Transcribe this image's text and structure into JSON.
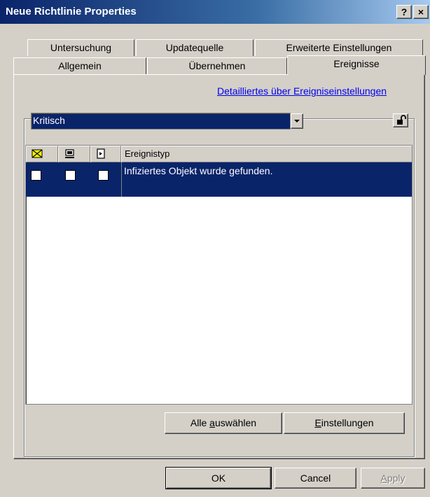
{
  "window": {
    "title": "Neue Richtlinie Properties",
    "help_button": "?",
    "close_button": "×"
  },
  "tabs": {
    "row_top": [
      "Untersuchung",
      "Updatequelle",
      "Erweiterte Einstellungen"
    ],
    "row_bottom": [
      "Allgemein",
      "Übernehmen",
      "Ereignisse"
    ],
    "active": "Ereignisse"
  },
  "events": {
    "details_link": "Detailliertes über Ereigniseinstellungen",
    "severity": {
      "selected": "Kritisch"
    },
    "table": {
      "header_icons": [
        "mail-icon",
        "monitor-icon",
        "log-icon"
      ],
      "column_header": "Ereignistyp",
      "rows": [
        {
          "label": "Infiziertes Objekt wurde gefunden.",
          "checks": [
            false,
            false,
            false
          ],
          "selected": true
        }
      ]
    },
    "select_all_prefix": "Alle ",
    "select_all_underline": "a",
    "select_all_rest": "uswählen",
    "settings_underline": "E",
    "settings_rest": "instellungen"
  },
  "footer": {
    "ok": "OK",
    "cancel": "Cancel",
    "apply_underline": "A",
    "apply_rest": "pply"
  }
}
